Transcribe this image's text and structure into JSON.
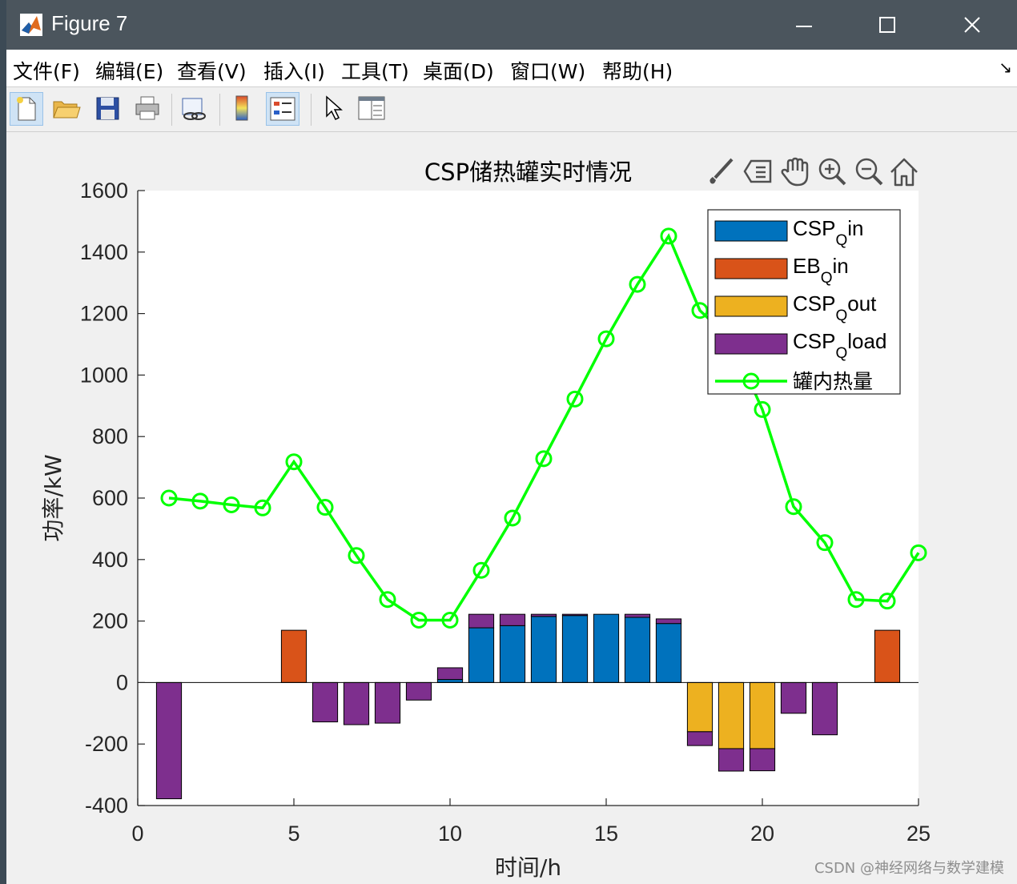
{
  "window": {
    "title": "Figure 7"
  },
  "menu": [
    "文件(F)",
    "编辑(E)",
    "查看(V)",
    "插入(I)",
    "工具(T)",
    "桌面(D)",
    "窗口(W)",
    "帮助(H)"
  ],
  "toolbar": [
    "new-figure",
    "open-file",
    "save",
    "print",
    "link-plot",
    "colorbar",
    "legend",
    "edit-plot",
    "property-inspector"
  ],
  "axes_toolbar": [
    "brush",
    "data-tips",
    "pan",
    "zoom-in",
    "zoom-out",
    "restore-view"
  ],
  "watermark": "CSDN @神经网络与数学建模",
  "colors": {
    "csp_in": "#0072BD",
    "eb_in": "#D95319",
    "csp_out": "#EDB120",
    "csp_load": "#7E2F8E",
    "heat": "#00FF00"
  },
  "chart_data": {
    "type": "bar",
    "title": "CSP储热罐实时情况",
    "xlabel": "时间/h",
    "ylabel": "功率/kW",
    "xlim": [
      0,
      25
    ],
    "ylim": [
      -400,
      1600
    ],
    "xticks": [
      0,
      5,
      10,
      15,
      20,
      25
    ],
    "yticks": [
      -400,
      -200,
      0,
      200,
      400,
      600,
      800,
      1000,
      1200,
      1400,
      1600
    ],
    "legend_position": "top-right",
    "x": [
      1,
      2,
      3,
      4,
      5,
      6,
      7,
      8,
      9,
      10,
      11,
      12,
      13,
      14,
      15,
      16,
      17,
      18,
      19,
      20,
      21,
      22,
      23,
      24
    ],
    "stacked_series": [
      {
        "key": "csp_in",
        "label_main": "CSP",
        "label_sub": "Q",
        "label_tail": "in",
        "values": [
          0,
          0,
          0,
          0,
          0,
          0,
          0,
          0,
          0,
          10,
          178,
          185,
          215,
          218,
          222,
          212,
          192,
          0,
          0,
          0,
          0,
          0,
          0,
          0
        ]
      },
      {
        "key": "eb_in",
        "label_main": "EB",
        "label_sub": "Q",
        "label_tail": "in",
        "values": [
          0,
          0,
          0,
          0,
          170,
          0,
          0,
          0,
          0,
          0,
          0,
          0,
          0,
          0,
          0,
          0,
          0,
          0,
          0,
          0,
          0,
          0,
          0,
          170
        ]
      },
      {
        "key": "csp_out",
        "label_main": "CSP",
        "label_sub": "Q",
        "label_tail": "out",
        "values": [
          0,
          0,
          0,
          0,
          0,
          0,
          0,
          0,
          0,
          0,
          0,
          0,
          0,
          0,
          0,
          0,
          0,
          -160,
          -215,
          -215,
          0,
          0,
          0,
          0
        ]
      },
      {
        "key": "csp_load",
        "label_main": "CSP",
        "label_sub": "Q",
        "label_tail": "load",
        "values": [
          -378,
          0,
          0,
          0,
          0,
          -128,
          -137,
          -132,
          -57,
          38,
          44,
          37,
          7,
          4,
          0,
          10,
          15,
          -45,
          -73,
          -72,
          -100,
          -170,
          0,
          0
        ]
      }
    ],
    "line_series": {
      "key": "heat",
      "name": "罐内热量",
      "values": [
        600,
        590,
        578,
        568,
        718,
        570,
        413,
        270,
        203,
        203,
        365,
        535,
        728,
        922,
        1118,
        1295,
        1452,
        1210,
        1115,
        888,
        572,
        455,
        270,
        265,
        422
      ]
    }
  }
}
